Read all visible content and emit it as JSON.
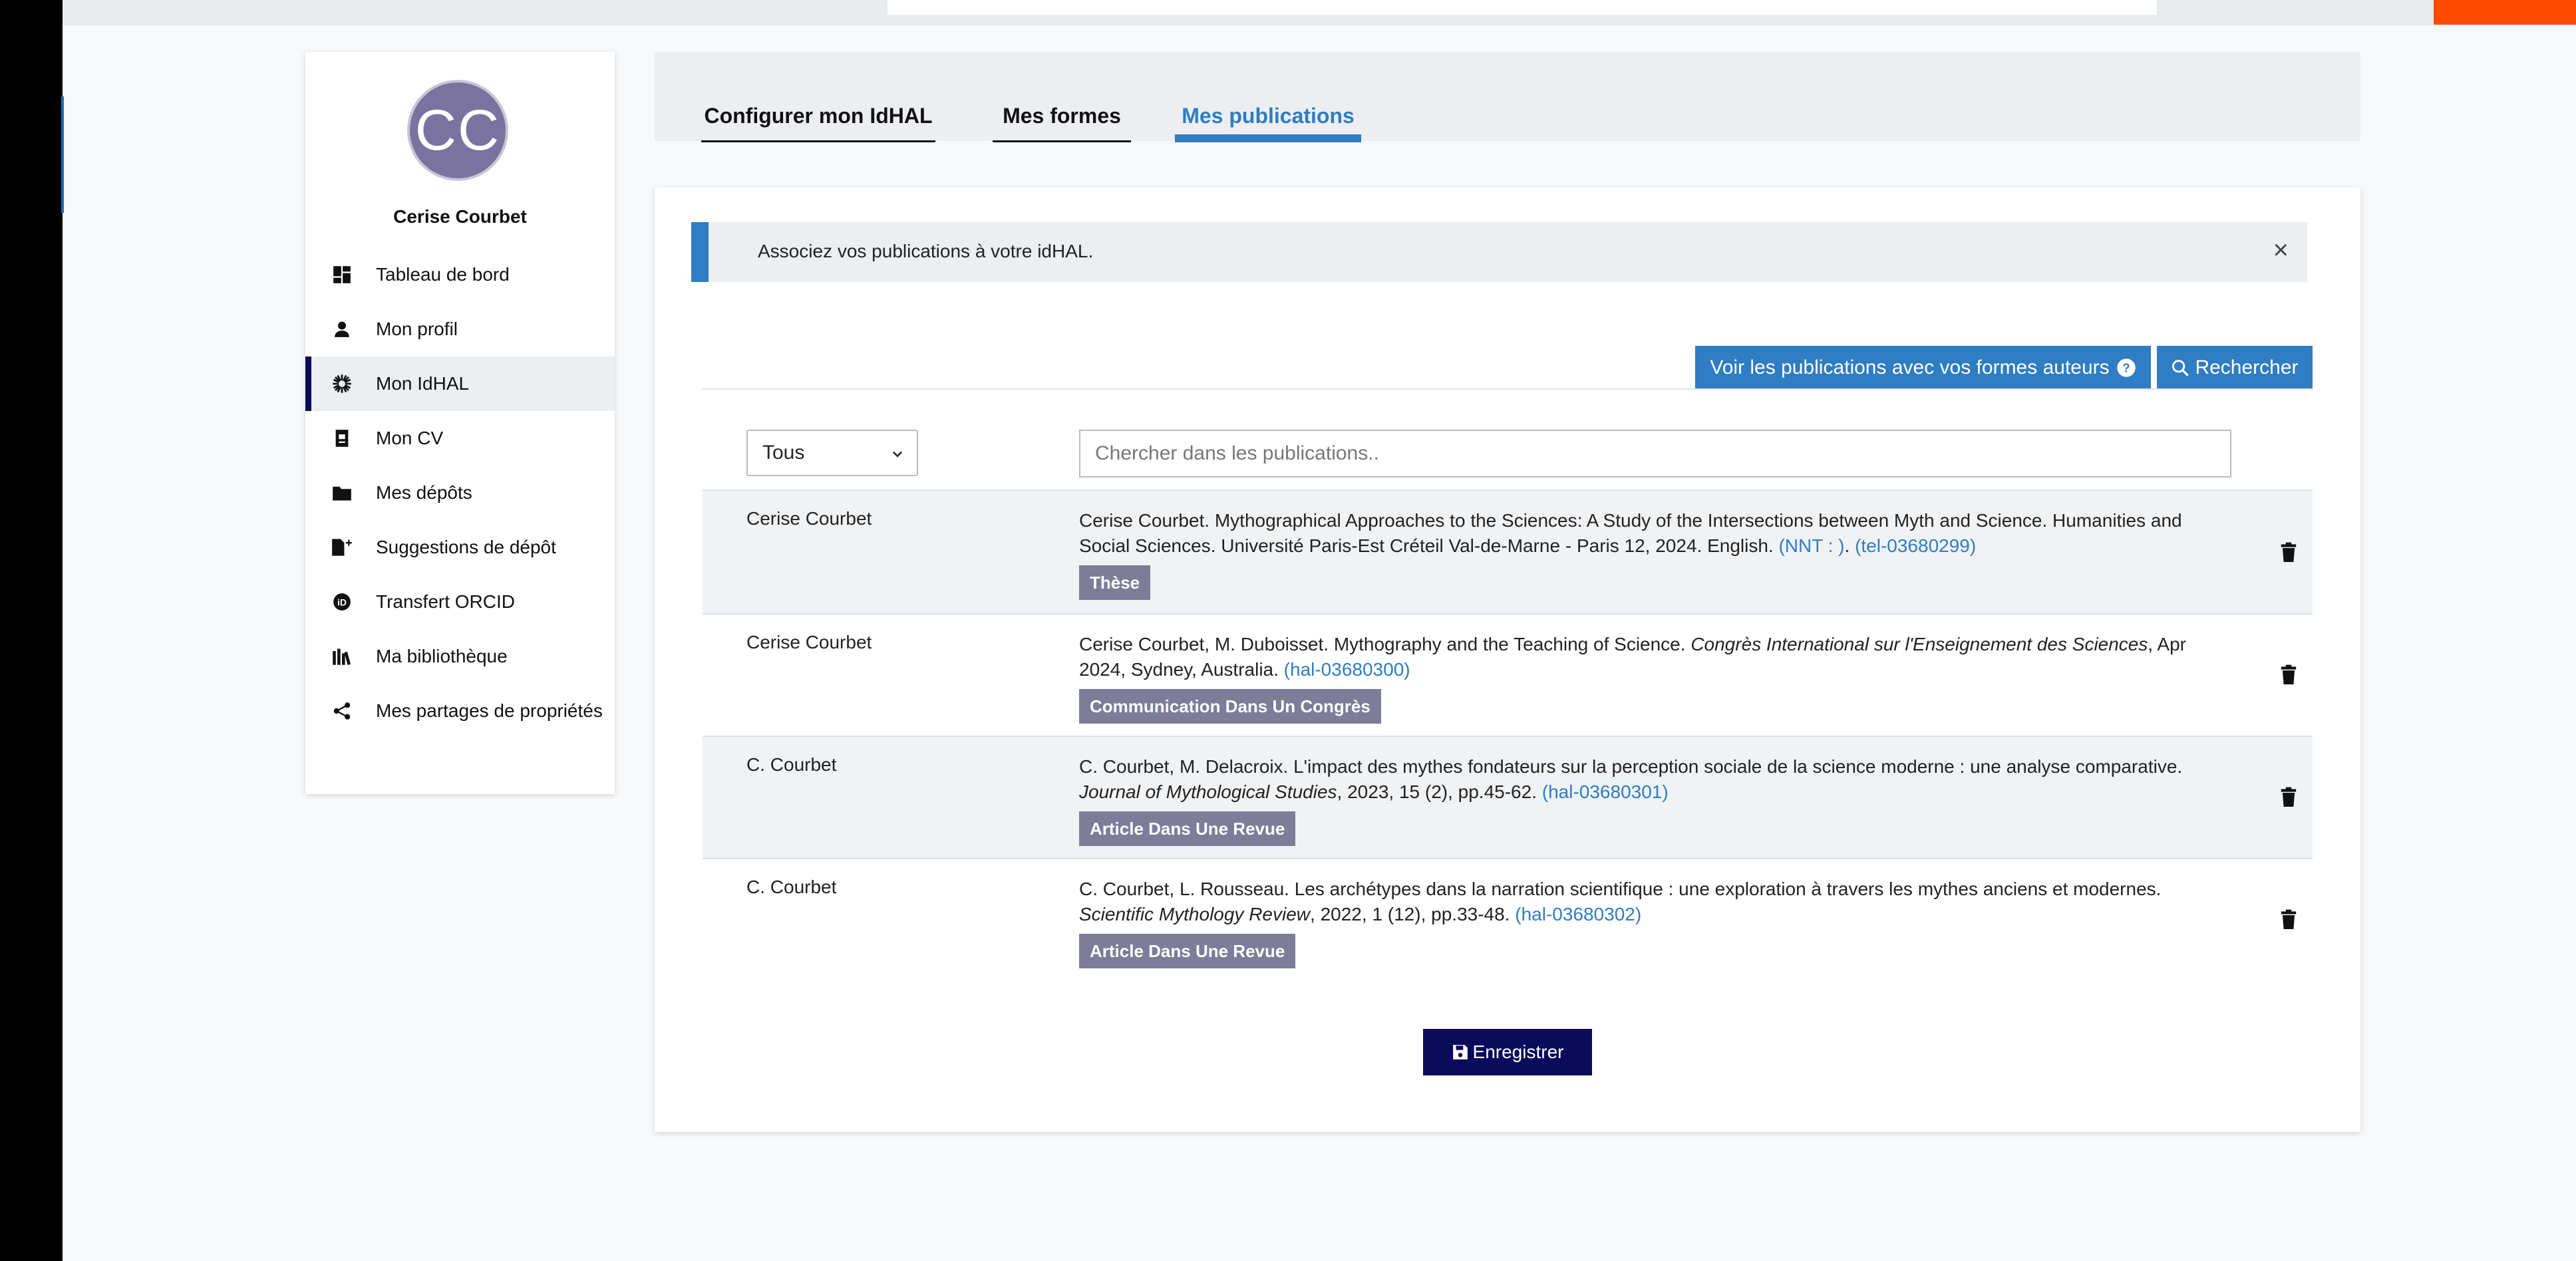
{
  "colors": {
    "accent": "#2f7dc2",
    "sidebar_active": "#0b0b5c",
    "badge": "#7d7c99",
    "topbar_orange": "#ff4b00",
    "avatar": "#7a73a0"
  },
  "user": {
    "initials": "CC",
    "name": "Cerise Courbet"
  },
  "sidebar": {
    "items": [
      {
        "label": "Tableau de bord",
        "icon": "dashboard-icon"
      },
      {
        "label": "Mon profil",
        "icon": "person-icon"
      },
      {
        "label": "Mon IdHAL",
        "icon": "idhal-icon",
        "active": true
      },
      {
        "label": "Mon CV",
        "icon": "cv-icon"
      },
      {
        "label": "Mes dépôts",
        "icon": "folder-icon"
      },
      {
        "label": "Suggestions de dépôt",
        "icon": "file-plus-icon"
      },
      {
        "label": "Transfert ORCID",
        "icon": "orcid-icon"
      },
      {
        "label": "Ma bibliothèque",
        "icon": "library-icon"
      },
      {
        "label": "Mes partages de propriétés",
        "icon": "share-icon"
      }
    ]
  },
  "tabs": [
    {
      "label": "Configurer mon IdHAL"
    },
    {
      "label": "Mes formes"
    },
    {
      "label": "Mes publications",
      "active": true
    }
  ],
  "alert": {
    "text": "Associez vos publications à votre idHAL.",
    "close": "×"
  },
  "toolbar": {
    "voir_label": "Voir les publications avec vos formes auteurs",
    "search_label": "Rechercher"
  },
  "filter": {
    "selected": "Tous",
    "search_placeholder": "Chercher dans les publications.."
  },
  "publications": [
    {
      "author": "Cerise Courbet",
      "text": "Cerise Courbet. Mythographical Approaches to the Sciences: A Study of the Intersections between Myth and Science. Humanities and Social Sciences. Université Paris-Est Créteil Val-de-Marne - Paris 12, 2024. English. ",
      "link1": "(NNT : )",
      "sep": ". ",
      "link2": "(tel-03680299)",
      "badge": "Thèse"
    },
    {
      "author": "Cerise Courbet",
      "text": "Cerise Courbet, M. Duboisset. Mythography and the Teaching of Science. ",
      "venue": "Congrès International sur l'Enseignement des Sciences",
      "text2": ", Apr 2024, Sydney, Australia. ",
      "link": "(hal-03680300)",
      "badge": "Communication Dans Un Congrès"
    },
    {
      "author": "C. Courbet",
      "text": "C. Courbet, M. Delacroix. L'impact des mythes fondateurs sur la perception sociale de la science moderne : une analyse comparative. ",
      "venue": "Journal of Mythological Studies",
      "text2": ", 2023, 15 (2), pp.45-62. ",
      "link": "(hal-03680301)",
      "badge": "Article Dans Une Revue"
    },
    {
      "author": "C. Courbet",
      "text": "C. Courbet, L. Rousseau. Les archétypes dans la narration scientifique : une exploration à travers les mythes anciens et modernes. ",
      "venue": "Scientific Mythology Review",
      "text2": ", 2022, 1 (12), pp.33-48. ",
      "link": "(hal-03680302)",
      "badge": "Article Dans Une Revue"
    }
  ],
  "save_label": "Enregistrer"
}
